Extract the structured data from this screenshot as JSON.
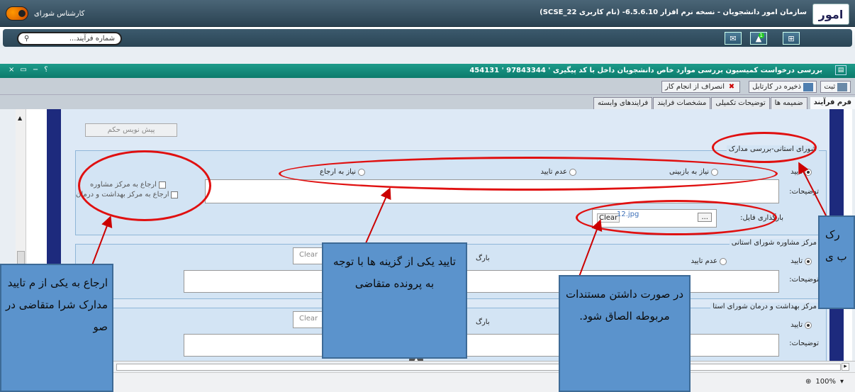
{
  "app": {
    "title": "سازمان امور دانشجویان - نسخه نرم افزار 6.5.6.10- (نام کاربری SCSE_22)",
    "logo_text": "امور",
    "user_role": "کارشناس شورای"
  },
  "nav": {
    "search_placeholder": "شماره فرآیند...",
    "icons": [
      "mail-icon",
      "badge-icon",
      "network-icon"
    ],
    "badge_count": "1"
  },
  "window": {
    "title": "بررسی درخواست کمیسیون بررسی موارد خاص دانشجویان داخل با کد پیگیری ' 97843344 '   454131",
    "controls": [
      "×",
      "▭",
      "−",
      "؟"
    ]
  },
  "toolbar": {
    "register": "ثبت",
    "save_cartable": "ذخیره در کارتابل",
    "cancel": "انصراف از انجام کار"
  },
  "tabs": [
    "فرم فرآیند",
    "ضمیمه ها",
    "توضیحات تکمیلی",
    "مشخصات فرایند",
    "فرایندهای وابسته"
  ],
  "form": {
    "pre_verdict_button": "پیش نویس حکم",
    "section1": {
      "title": "شورای استانی-بررسی مدارک",
      "options": [
        "تایید",
        "نیاز به بازبینی",
        "عدم تایید",
        "نیاز به ارجاع"
      ],
      "notes_label": "توضیحات:",
      "checks": [
        "ارجاع به مرکز مشاوره",
        "ارجاع به مرکز بهداشت و درمان"
      ],
      "file_label": "بارگذاری فایل:",
      "file_name": "12.jpg",
      "browse": "...",
      "clear": "Clear"
    },
    "section2": {
      "title": "مرکز مشاوره شورای استانی",
      "options": [
        "تایید",
        "عدم تایید"
      ],
      "notes_label": "توضیحات:",
      "file_label_fragment": "بارگ",
      "clear": "Clear"
    },
    "section3": {
      "title": "مرکز بهداشت و درمان شورای استا",
      "options": [
        "تایید"
      ],
      "notes_label": "توضیحات:",
      "file_label_fragment": "بارگ",
      "clear": "Clear"
    }
  },
  "annotations": {
    "left": "ارجاع به یکی از م تایید مدارک شرا متقاضی در صو",
    "middle": "تایید یکی از گزینه ها با توجه به پرونده متقاضی",
    "center": "در صورت داشتن مستندات مربوطه الصاق شود.",
    "right": "رک ب ی"
  },
  "status": {
    "zoom": "100%"
  }
}
